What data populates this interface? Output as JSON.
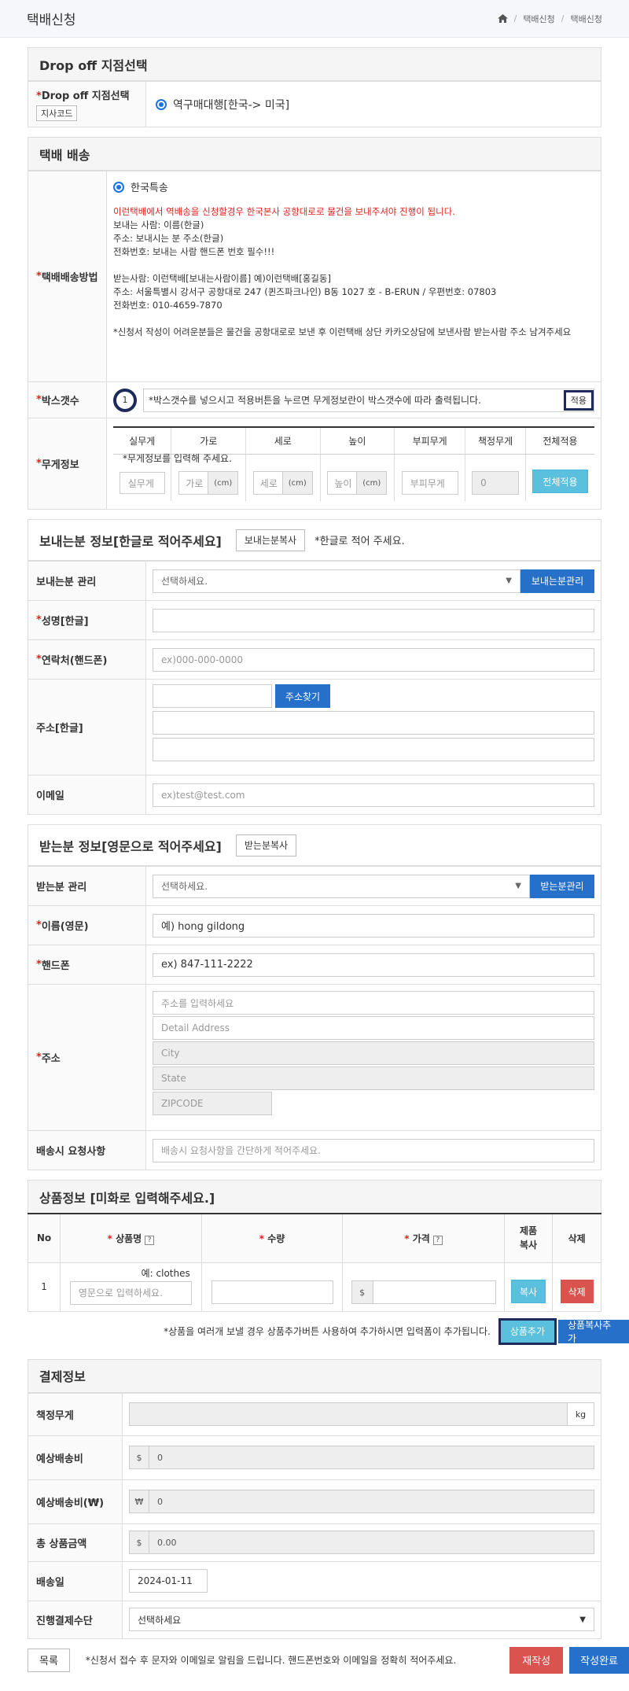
{
  "header": {
    "title": "택배신청",
    "breadcrumb": [
      "택배신청",
      "택배신청"
    ]
  },
  "dropoff": {
    "section_title": "Drop off 지점선택",
    "label": "Drop off 지점선택",
    "code_button": "지사코드",
    "option": "역구매대행[한국-> 미국]"
  },
  "delivery": {
    "section_title": "택배 배송",
    "method_label": "택배배송방법",
    "method_option": "한국특송",
    "notice_red": "이런택배에서 역배송을 신청할경우 한국본사 공항대로로 물건을 보내주셔야 진행이 됩니다.",
    "lines1": [
      "보내는 사람: 이름(한글)",
      "주소: 보내시는 분 주소(한글)",
      "전화번호: 보내는 사람 핸드폰 번호 필수!!!"
    ],
    "lines2": [
      "받는사람: 이런택배[보내는사람이름] 예)이런택배[홍길동]",
      "주소: 서울특별시 강서구 공항대로 247 (퀸즈파크나인) B동 1027 호 - B-ERUN / 우편번호: 07803",
      "전화번호: 010-4659-7870"
    ],
    "line3": "*신청서 작성이 어려운분들은 물건을 공항대로로 보낸 후 이런택배 상단 카카오상담에 보낸사람 받는사람 주소 남겨주세요",
    "box_label": "박스갯수",
    "box_value": "1",
    "box_hint": "*박스갯수를 넣으시고 적용버튼을 누르면 무게정보란이 박스갯수에 따라 출력됩니다.",
    "apply_button": "적용",
    "weight_label": "무게정보",
    "weight_headers": [
      "실무게",
      "가로",
      "세로",
      "높이",
      "부피무게",
      "책정무게",
      "전체적용"
    ],
    "weight_hint": "*무게정보를 입력해 주세요.",
    "ph_real": "실무게",
    "ph_width": "가로",
    "ph_depth": "세로",
    "ph_height": "높이",
    "ph_volume": "부피무게",
    "unit_cm": "(cm)",
    "charged_value": "0",
    "apply_all_button": "전체적용"
  },
  "sender": {
    "section_title": "보내는분 정보[한글로 적어주세요]",
    "copy_button": "보내는분복사",
    "hint": "*한글로 적어 주세요.",
    "manage_label": "보내는분 관리",
    "manage_select": "선택하세요.",
    "manage_button": "보내는분관리",
    "name_label": "성명[한글]",
    "phone_label": "연락처(핸드폰)",
    "phone_placeholder": "ex)000-000-0000",
    "address_label": "주소[한글]",
    "address_button": "주소찾기",
    "email_label": "이메일",
    "email_placeholder": "ex)test@test.com"
  },
  "receiver": {
    "section_title": "받는분 정보[영문으로 적어주세요]",
    "copy_button": "받는분복사",
    "manage_label": "받는분 관리",
    "manage_select": "선택하세요.",
    "manage_button": "받는분관리",
    "name_label": "이름(영문)",
    "name_placeholder": "예) hong gildong",
    "phone_label": "핸드폰",
    "phone_placeholder": "ex) 847-111-2222",
    "address_label": "주소",
    "addr1_placeholder": "주소를 입력하세요",
    "addr2_placeholder": "Detail Address",
    "city_placeholder": "City",
    "state_placeholder": "State",
    "zip_placeholder": "ZIPCODE",
    "request_label": "배송시 요청사항",
    "request_placeholder": "배송시 요청사항을 간단하게 적어주세요."
  },
  "products": {
    "section_title": "상품정보 [미화로 입력해주세요.]",
    "headers": {
      "no": "No",
      "name": "상품명",
      "qty": "수량",
      "price": "가격",
      "copy": "제품\n복사",
      "delete": "삭제"
    },
    "row_no": "1",
    "name_hint": "예: clothes",
    "name_placeholder": "영문으로 입력하세요.",
    "currency": "$",
    "copy_button": "복사",
    "delete_button": "삭제",
    "footer_hint": "*상품을 여러개 보낼 경우 상품추가버튼 사용하여 추가하시면 입력폼이 추가됩니다.",
    "add_button": "상품추가",
    "add_copy_button": "상품복사추가"
  },
  "payment": {
    "section_title": "결제정보",
    "weight_label": "책정무게",
    "weight_unit": "kg",
    "fee_label": "예상배송비",
    "fee_currency": "$",
    "fee_value": "0",
    "fee_krw_label": "예상배송비(₩)",
    "fee_krw_currency": "₩",
    "fee_krw_value": "0",
    "total_label": "총 상품금액",
    "total_currency": "$",
    "total_value": "0.00",
    "date_label": "배송일",
    "date_value": "2024-01-11",
    "method_label": "진행결제수단",
    "method_select": "선택하세요"
  },
  "footer": {
    "list_button": "목록",
    "hint": "*신청서 접수 후 문자와 이메일로 알림을 드립니다. 핸드폰번호와 이메일을 정확히 적어주세요.",
    "rewrite_button": "재작성",
    "submit_button": "작성완료"
  },
  "colors": {
    "accent": "#2770c9",
    "cyan": "#5bc0de",
    "danger": "#d9534f",
    "required": "#e02020",
    "marker": "#1f2a5c"
  }
}
